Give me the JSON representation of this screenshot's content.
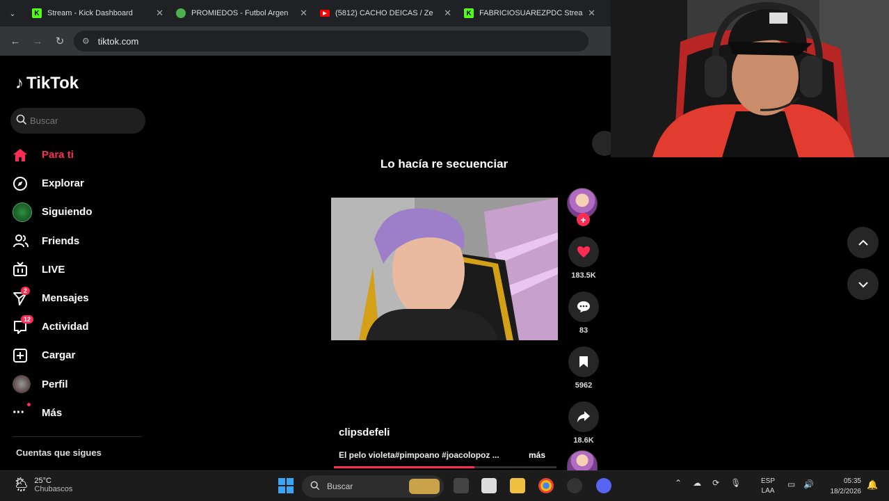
{
  "browser": {
    "tabs": [
      {
        "title": "Stream - Kick Dashboard",
        "icon": "kick-icon",
        "color": "#53fc18"
      },
      {
        "title": "PROMIEDOS - Futbol Argen",
        "icon": "promiedos-icon",
        "color": "#4caf50"
      },
      {
        "title": "(5812) CACHO DEICAS / Ze",
        "icon": "youtube-icon",
        "color": "#ff0000"
      },
      {
        "title": "FABRICIOSUAREZPDC Strea",
        "icon": "kick-icon",
        "color": "#53fc18"
      }
    ],
    "url": "tiktok.com"
  },
  "tiktok": {
    "logo": "TikTok",
    "search_placeholder": "Buscar",
    "nav": [
      {
        "label": "Para ti",
        "icon": "home-icon",
        "active": true
      },
      {
        "label": "Explorar",
        "icon": "compass-icon"
      },
      {
        "label": "Siguiendo",
        "icon": "following-avatar-icon"
      },
      {
        "label": "Friends",
        "icon": "friends-icon"
      },
      {
        "label": "LIVE",
        "icon": "live-tv-icon"
      },
      {
        "label": "Mensajes",
        "icon": "send-icon",
        "badge": "2"
      },
      {
        "label": "Actividad",
        "icon": "activity-icon",
        "badge": "12"
      },
      {
        "label": "Cargar",
        "icon": "upload-icon"
      },
      {
        "label": "Perfil",
        "icon": "profile-avatar-icon"
      },
      {
        "label": "Más",
        "icon": "more-dots-icon",
        "dot": true
      }
    ],
    "following_header": "Cuentas que sigues",
    "video": {
      "title": "Lo hacía re secuenciar",
      "username": "clipsdefeli",
      "caption": "El pelo violeta#pimpoano #joacolopoz ...",
      "more": "más",
      "progress": 0.63
    },
    "actions": {
      "likes": "183.5K",
      "comments": "83",
      "saves": "5962",
      "shares": "18.6K"
    },
    "accent": "#fe2c55"
  },
  "taskbar": {
    "weather_temp": "25°C",
    "weather_desc": "Chubascos",
    "search": "Buscar",
    "lang1": "ESP",
    "lang2": "LAA",
    "time": "05:35",
    "date": "18/2/2026"
  }
}
